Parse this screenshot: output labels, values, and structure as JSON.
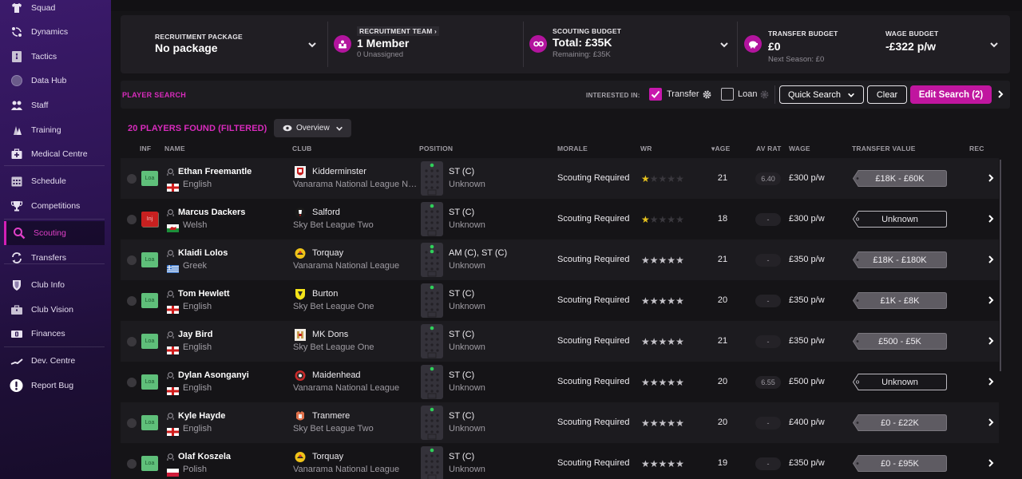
{
  "sidebar": {
    "items": [
      {
        "label": "Squad",
        "icon": "shirt-icon"
      },
      {
        "label": "Dynamics",
        "icon": "dynamics-icon"
      },
      {
        "label": "Tactics",
        "icon": "tactics-board-icon"
      },
      {
        "label": "Data Hub",
        "icon": "data-hub-icon"
      },
      {
        "label": "Staff",
        "icon": "staff-icon"
      },
      {
        "label": "Training",
        "icon": "training-cone-icon"
      },
      {
        "label": "Medical Centre",
        "icon": "medical-kit-icon"
      },
      {
        "label": "Schedule",
        "icon": "calendar-icon"
      },
      {
        "label": "Competitions",
        "icon": "trophy-icon"
      },
      {
        "label": "Scouting",
        "icon": "magnifier-icon",
        "active": true
      },
      {
        "label": "Transfers",
        "icon": "transfer-arrows-icon"
      },
      {
        "label": "Club Info",
        "icon": "shield-icon"
      },
      {
        "label": "Club Vision",
        "icon": "briefcase-icon"
      },
      {
        "label": "Finances",
        "icon": "banknote-icon"
      },
      {
        "label": "Dev. Centre",
        "icon": "dev-centre-icon"
      },
      {
        "label": "Report Bug",
        "icon": "exclamation-icon"
      }
    ]
  },
  "budget": {
    "recruitment_package": {
      "label": "RECRUITMENT PACKAGE",
      "value": "No package"
    },
    "recruitment_team": {
      "label": "RECRUITMENT TEAM",
      "value": "1 Member",
      "sub": "0 Unassigned"
    },
    "scouting_budget": {
      "label": "SCOUTING BUDGET",
      "value": "Total: £35K",
      "sub": "Remaining: £35K"
    },
    "transfer_budget": {
      "label": "TRANSFER BUDGET",
      "value": "£0",
      "sub": "Next Season: £0"
    },
    "wage_budget": {
      "label": "WAGE BUDGET",
      "value": "-£322 p/w"
    }
  },
  "search": {
    "title": "PLAYER SEARCH",
    "interested_label": "INTERESTED IN:",
    "transfer_label": "Transfer",
    "transfer_checked": true,
    "loan_label": "Loan",
    "loan_checked": false,
    "quick_search_label": "Quick Search",
    "clear_label": "Clear",
    "edit_search_label": "Edit Search (2)"
  },
  "results": {
    "found_label": "20 PLAYERS FOUND (FILTERED)",
    "view_label": "Overview"
  },
  "columns": {
    "inf": "INF",
    "name": "NAME",
    "club": "CLUB",
    "position": "POSITION",
    "morale": "MORALE",
    "wr": "WR",
    "age": "AGE",
    "av_rat": "AV RAT",
    "wage": "WAGE",
    "transfer_value": "TRANSFER VALUE",
    "rec": "REC"
  },
  "colors": {
    "accent": "#c0169f",
    "accent_text": "#d92bbd",
    "loan_badge": "#5fbf7a",
    "injury_badge": "#c82020",
    "star_gold": "#e6c21e"
  },
  "players": [
    {
      "inf": "Loa",
      "name": "Ethan Freemantle",
      "nationality": "English",
      "flag": "england",
      "club": "Kidderminster",
      "crest": "kidderminster",
      "league": "Vanarama National League North",
      "position": "ST (C)",
      "position_sub": "Unknown",
      "morale": "Scouting Required",
      "wr_stars": 0.5,
      "wr_known": true,
      "age": "21",
      "av_rat": "6.40",
      "wage": "£300 p/w",
      "transfer_value": "£18K - £60K",
      "tv_known": true
    },
    {
      "inf": "Inj",
      "name": "Marcus Dackers",
      "nationality": "Welsh",
      "flag": "wales",
      "club": "Salford",
      "crest": "salford",
      "league": "Sky Bet League Two",
      "position": "ST (C)",
      "position_sub": "Unknown",
      "morale": "Scouting Required",
      "wr_stars": 0.5,
      "wr_known": true,
      "age": "18",
      "av_rat": "-",
      "wage": "£300 p/w",
      "transfer_value": "Unknown",
      "tv_known": false
    },
    {
      "inf": "Loa",
      "name": "Klaidi Lolos",
      "nationality": "Greek",
      "flag": "greece",
      "club": "Torquay",
      "crest": "torquay",
      "league": "Vanarama National League",
      "position": "AM (C), ST (C)",
      "position_sub": "Unknown",
      "morale": "Scouting Required",
      "wr_stars": 5,
      "wr_known": false,
      "age": "21",
      "av_rat": "-",
      "wage": "£350 p/w",
      "transfer_value": "£18K - £180K",
      "tv_known": true
    },
    {
      "inf": "Loa",
      "name": "Tom Hewlett",
      "nationality": "English",
      "flag": "england",
      "club": "Burton",
      "crest": "burton",
      "league": "Sky Bet League One",
      "position": "ST (C)",
      "position_sub": "Unknown",
      "morale": "Scouting Required",
      "wr_stars": 5,
      "wr_known": false,
      "age": "20",
      "av_rat": "-",
      "wage": "£350 p/w",
      "transfer_value": "£1K - £8K",
      "tv_known": true
    },
    {
      "inf": "Loa",
      "name": "Jay Bird",
      "nationality": "English",
      "flag": "england",
      "club": "MK Dons",
      "crest": "mkdons",
      "league": "Sky Bet League One",
      "position": "ST (C)",
      "position_sub": "Unknown",
      "morale": "Scouting Required",
      "wr_stars": 5,
      "wr_known": false,
      "age": "21",
      "av_rat": "-",
      "wage": "£350 p/w",
      "transfer_value": "£500 - £5K",
      "tv_known": true
    },
    {
      "inf": "Loa",
      "name": "Dylan Asonganyi",
      "nationality": "English",
      "flag": "england",
      "club": "Maidenhead",
      "crest": "maidenhead",
      "league": "Vanarama National League",
      "position": "ST (C)",
      "position_sub": "Unknown",
      "morale": "Scouting Required",
      "wr_stars": 5,
      "wr_known": false,
      "age": "20",
      "av_rat": "6.55",
      "wage": "£500 p/w",
      "transfer_value": "Unknown",
      "tv_known": false
    },
    {
      "inf": "Loa",
      "name": "Kyle Hayde",
      "nationality": "English",
      "flag": "england",
      "club": "Tranmere",
      "crest": "tranmere",
      "league": "Sky Bet League Two",
      "position": "ST (C)",
      "position_sub": "Unknown",
      "morale": "Scouting Required",
      "wr_stars": 5,
      "wr_known": false,
      "age": "20",
      "av_rat": "-",
      "wage": "£400 p/w",
      "transfer_value": "£0 - £22K",
      "tv_known": true
    },
    {
      "inf": "Loa",
      "name": "Olaf Koszela",
      "nationality": "Polish",
      "flag": "poland",
      "club": "Torquay",
      "crest": "torquay",
      "league": "Vanarama National League",
      "position": "ST (C)",
      "position_sub": "Unknown",
      "morale": "Scouting Required",
      "wr_stars": 5,
      "wr_known": false,
      "age": "19",
      "av_rat": "-",
      "wage": "£350 p/w",
      "transfer_value": "£0 - £95K",
      "tv_known": true
    }
  ]
}
